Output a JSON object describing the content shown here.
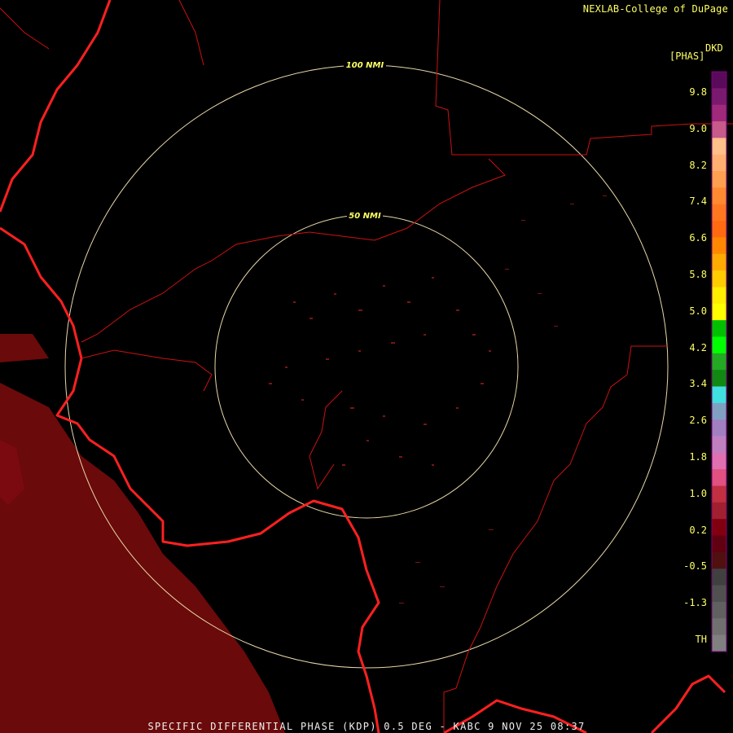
{
  "credit": "NEXLAB-College of DuPage",
  "footer": "SPECIFIC DIFFERENTIAL PHASE (KDP) 0.5 DEG - KABC 9 NOV 25 08:37",
  "rings": [
    {
      "label": "100 NMI",
      "radius_nmi": 100
    },
    {
      "label": "50 NMI",
      "radius_nmi": 50
    }
  ],
  "legend": {
    "product": "DKD",
    "units": "[PHAS]",
    "tick_labels": [
      "9.8",
      "9.0",
      "8.2",
      "7.4",
      "6.6",
      "5.8",
      "5.0",
      "4.2",
      "3.4",
      "2.6",
      "1.8",
      "1.0",
      "0.2",
      "-0.5",
      "-1.3",
      "TH"
    ],
    "color_stops": [
      "#5a0a5a",
      "#7a1a6e",
      "#a02a7a",
      "#c65a8a",
      "#ffc08a",
      "#ffb070",
      "#ffa050",
      "#ff8a30",
      "#ff7820",
      "#ff6a10",
      "#ff8800",
      "#ffaa00",
      "#ffcc00",
      "#ffee00",
      "#ffff00",
      "#00c000",
      "#00ff00",
      "#22aa22",
      "#118811",
      "#40e0e0",
      "#80a0c0",
      "#a080c0",
      "#c080c0",
      "#e070b0",
      "#e05080",
      "#c03040",
      "#a02030",
      "#800010",
      "#600010",
      "#501010",
      "#404040",
      "#505050",
      "#606060",
      "#707070",
      "#808080"
    ],
    "colors": {
      "label": "#ffff66",
      "background": "#000000",
      "border": "#800080"
    }
  },
  "map_colors": {
    "coast": "#ff2020",
    "boundary": "#cc1111",
    "rings": "#e8d8a8",
    "echo": "#6a0a0a",
    "clutter": "#7a1515"
  }
}
